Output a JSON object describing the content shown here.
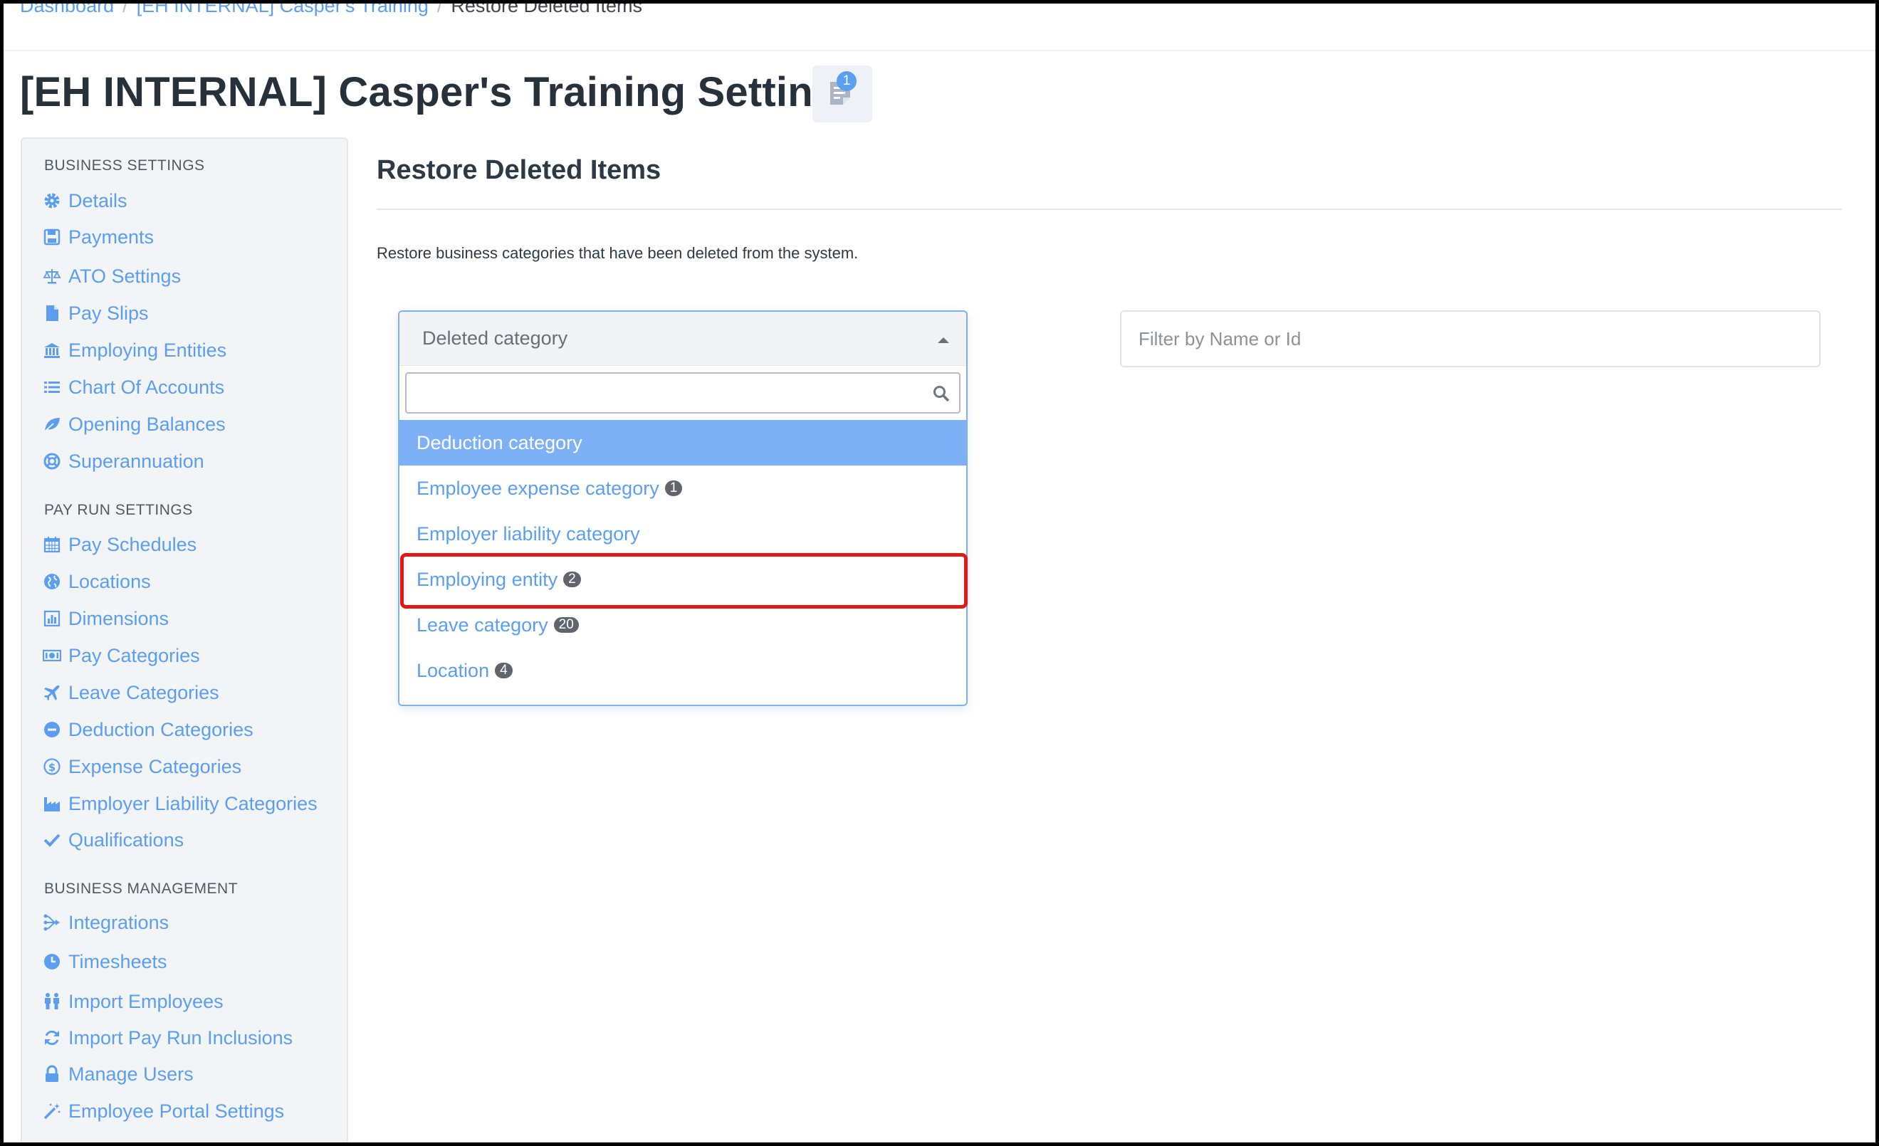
{
  "breadcrumb": {
    "items": [
      "Dashboard",
      "[EH INTERNAL] Casper's Training"
    ],
    "current": "Restore Deleted Items",
    "separator": "/"
  },
  "page_title": "[EH INTERNAL] Casper's Training Settings",
  "notes": {
    "count": "1",
    "icon": "notes-icon"
  },
  "sidebar": {
    "business_settings": {
      "title": "BUSINESS SETTINGS",
      "items": [
        {
          "label": "Details",
          "icon": "gear-icon"
        },
        {
          "label": "Payments",
          "icon": "floppy-disk-icon"
        },
        {
          "label": "ATO Settings",
          "icon": "scales-icon"
        },
        {
          "label": "Pay Slips",
          "icon": "document-icon"
        },
        {
          "label": "Employing Entities",
          "icon": "bank-icon"
        },
        {
          "label": "Chart Of Accounts",
          "icon": "list-icon"
        },
        {
          "label": "Opening Balances",
          "icon": "leaf-icon"
        },
        {
          "label": "Superannuation",
          "icon": "lifebuoy-icon"
        }
      ]
    },
    "pay_run_settings": {
      "title": "PAY RUN SETTINGS",
      "items": [
        {
          "label": "Pay Schedules",
          "icon": "calendar-icon"
        },
        {
          "label": "Locations",
          "icon": "globe-icon"
        },
        {
          "label": "Dimensions",
          "icon": "bar-chart-icon"
        },
        {
          "label": "Pay Categories",
          "icon": "money-icon"
        },
        {
          "label": "Leave Categories",
          "icon": "plane-icon"
        },
        {
          "label": "Deduction Categories",
          "icon": "minus-circle-icon"
        },
        {
          "label": "Expense Categories",
          "icon": "dollar-circle-icon"
        },
        {
          "label": "Employer Liability Categories",
          "icon": "factory-icon"
        },
        {
          "label": "Qualifications",
          "icon": "check-icon"
        }
      ]
    },
    "business_management": {
      "title": "BUSINESS MANAGEMENT",
      "items": [
        {
          "label": "Integrations",
          "icon": "integrations-icon"
        },
        {
          "label": "Timesheets",
          "icon": "clock-icon"
        },
        {
          "label": "Import Employees",
          "icon": "people-icon"
        },
        {
          "label": "Import Pay Run Inclusions",
          "icon": "refresh-icon"
        },
        {
          "label": "Manage Users",
          "icon": "lock-icon"
        },
        {
          "label": "Employee Portal Settings",
          "icon": "magic-wand-icon"
        }
      ]
    }
  },
  "content": {
    "title": "Restore Deleted Items",
    "description": "Restore business categories that have been deleted from the system."
  },
  "category_select": {
    "placeholder": "Deleted category",
    "search_value": "",
    "options": [
      {
        "label": "Deduction category",
        "count": ""
      },
      {
        "label": "Employee expense category",
        "count": "1"
      },
      {
        "label": "Employer liability category",
        "count": ""
      },
      {
        "label": "Employing entity",
        "count": "2"
      },
      {
        "label": "Leave category",
        "count": "20"
      },
      {
        "label": "Location",
        "count": "4"
      }
    ]
  },
  "filter": {
    "placeholder": "Filter by Name or Id",
    "value": ""
  },
  "colors": {
    "link": "#5b9ef0",
    "highlight_option": "#7eb0f8",
    "annotation_box": "#e01818",
    "badge": "#5f656c"
  }
}
